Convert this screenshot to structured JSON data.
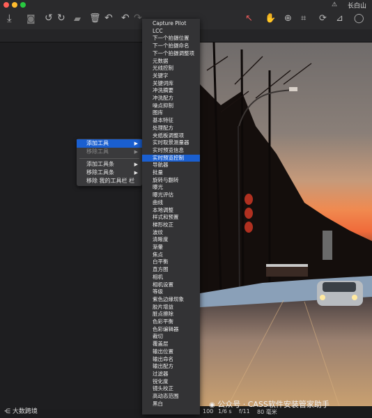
{
  "window": {
    "title": "长白山"
  },
  "context_menu": {
    "items": [
      {
        "label": "添加工具",
        "has_submenu": true,
        "highlighted": true,
        "disabled": false
      },
      {
        "label": "移除工具",
        "has_submenu": true,
        "highlighted": false,
        "disabled": true
      },
      {
        "label": "添加工具条",
        "has_submenu": true,
        "highlighted": false,
        "disabled": false
      },
      {
        "label": "移除工具条",
        "has_submenu": true,
        "highlighted": false,
        "disabled": false
      },
      {
        "label": "移除 我的工具栏 栏",
        "has_submenu": false,
        "highlighted": false,
        "disabled": false
      }
    ],
    "arrow_glyph": "▶"
  },
  "submenu": {
    "highlighted_index": 18,
    "items": [
      "Capture Pilot",
      "LCC",
      "下一个拍摄位置",
      "下一个拍摄命名",
      "下一个拍摄调整项",
      "元数据",
      "光线控制",
      "关键字",
      "关键词库",
      "冲洗摘要",
      "冲洗配方",
      "噪点抑制",
      "图库",
      "基本特征",
      "处理配方",
      "夹纸板调整项",
      "实时取景测量器",
      "实时预览信息",
      "实时预览控制",
      "导航器",
      "批量",
      "旋转与翻转",
      "曝光",
      "曝光评估",
      "曲线",
      "本地调整",
      "样式和预置",
      "梯形校正",
      "波纹",
      "清晰度",
      "渐暈",
      "焦点",
      "白平衡",
      "直方图",
      "相机",
      "相机设置",
      "等级",
      "紫色边缘现象",
      "胶片增益",
      "脏点擦除",
      "色彩平衡",
      "色彩编辑器",
      "裁切",
      "覆盖层",
      "输出位置",
      "输出命名",
      "输出配方",
      "过滤器",
      "锐化度",
      "镜头校正",
      "高动态范围",
      "黑白"
    ]
  },
  "status_bar": {
    "iso": "100",
    "shutter": "1/6 s",
    "aperture": "f/11",
    "focal": "80 毫米"
  },
  "watermark": {
    "text": "公众号 · CASS软件安装管家助手"
  },
  "corner_logo": {
    "text": "大数跨境"
  },
  "colors": {
    "menu_highlight": "#1a5fd0",
    "menu_bg": "#3a3a3c",
    "submenu_bg": "#333335",
    "accent_blue": "#2e6bd6"
  }
}
